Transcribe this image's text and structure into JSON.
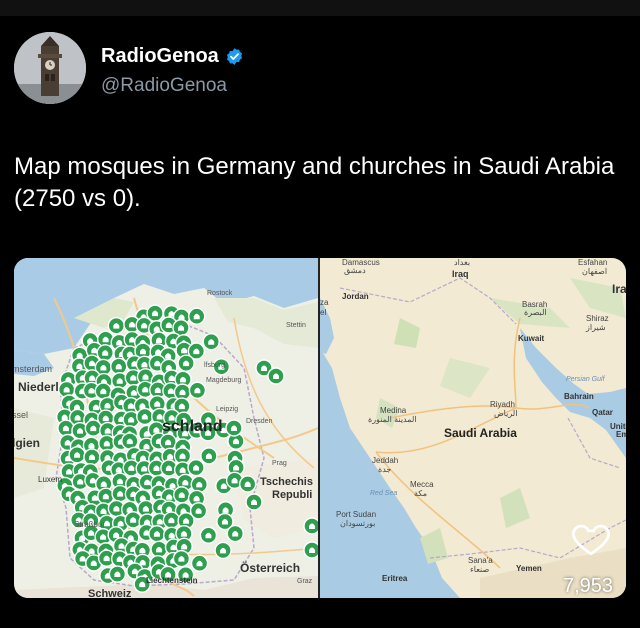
{
  "author": {
    "display_name": "RadioGenoa",
    "handle": "@RadioGenoa",
    "verified": true,
    "verified_color": "#1d9bf0",
    "avatar_icon": "clock-tower-icon"
  },
  "tweet": {
    "text": "Map mosques in Germany and churches in Saudi Arabia (2750 vs 0)."
  },
  "media": {
    "germany_map": {
      "marker_icon": "mosque-marker-icon",
      "marker_color": "#2e9e4f",
      "labels": {
        "amsterdam": "msterdam",
        "niederlande": "Niederl",
        "bruessel": "ssel",
        "belgien": "lgien",
        "luxemburg": "Luxem",
        "strassburg": "Straßbur",
        "schweiz": "Schweiz",
        "liechtenstein": "Liechtenstein",
        "deutschland": "schland",
        "rostock": "Rostock",
        "stettin": "Stettin",
        "wolfsburg": "lfsburg",
        "magdeburg": "Magdeburg",
        "leipzig": "Leipzig",
        "dresden": "Dresden",
        "prag": "Prag",
        "tschechische": "Tschechis",
        "republik": "Republi",
        "oesterreich": "Österreich",
        "graz": "Graz"
      }
    },
    "saudi_map": {
      "labels": {
        "damascus": "Damascus",
        "damascus_ar": "دمشق",
        "baghdad_ar": "بغداد",
        "iraq": "Iraq",
        "esfahan": "Esfahan",
        "esfahan_fa": "اصفهان",
        "iran": "Ira",
        "jordan": "Jordan",
        "za": "za",
        "el": "el",
        "basrah": "Basrah",
        "basrah_ar": "البصرة",
        "shiraz": "Shiraz",
        "shiraz_fa": "شیراز",
        "kuwait": "Kuwait",
        "persian_gulf": "Persian Gulf",
        "bahrain": "Bahrain",
        "qatar": "Qatar",
        "uae_1": "United",
        "uae_2": "Emir",
        "medina": "Medina",
        "medina_ar": "المدينة المنورة",
        "riyadh": "Riyadh",
        "riyadh_ar": "الرياض",
        "saudi_arabia": "Saudi Arabia",
        "jeddah": "Jeddah",
        "jeddah_ar": "جدة",
        "mecca": "Mecca",
        "mecca_ar": "مكة",
        "red_sea": "Red Sea",
        "port_sudan": "Port Sudan",
        "port_sudan_ar": "بورتسودان",
        "sanaa": "Sana'a",
        "sanaa_ar": "صنعاء",
        "yemen": "Yemen",
        "eritrea": "Eritrea"
      }
    }
  },
  "actions": {
    "like_icon": "heart-icon",
    "like_count": "7,953"
  }
}
